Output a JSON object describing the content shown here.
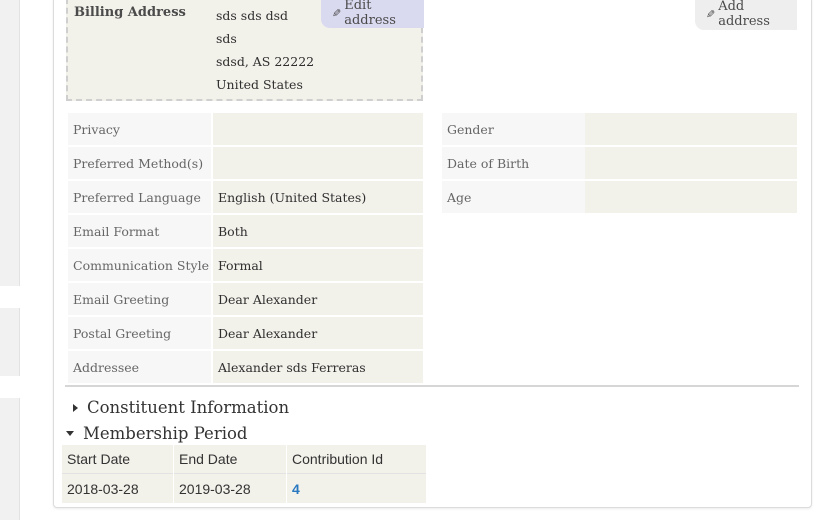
{
  "billing": {
    "label": "Billing Address",
    "lines": [
      "sds sds dsd",
      "sds",
      "sdsd, AS 22222",
      "United States"
    ],
    "edit_label": "Edit address"
  },
  "add_address_label": "Add address",
  "left_fields": [
    {
      "label": "Privacy",
      "value": ""
    },
    {
      "label": "Preferred Method(s)",
      "value": ""
    },
    {
      "label": "Preferred Language",
      "value": "English (United States)"
    },
    {
      "label": "Email Format",
      "value": "Both"
    },
    {
      "label": "Communication Style",
      "value": "Formal"
    },
    {
      "label": "Email Greeting",
      "value": "Dear Alexander"
    },
    {
      "label": "Postal Greeting",
      "value": "Dear Alexander"
    },
    {
      "label": "Addressee",
      "value": "Alexander sds Ferreras"
    }
  ],
  "right_fields": [
    {
      "label": "Gender",
      "value": ""
    },
    {
      "label": "Date of Birth",
      "value": ""
    },
    {
      "label": "Age",
      "value": ""
    }
  ],
  "sections": {
    "constituent": "Constituent Information",
    "membership": "Membership Period"
  },
  "membership_table": {
    "headers": [
      "Start Date",
      "End Date",
      "Contribution Id"
    ],
    "rows": [
      [
        "2018-03-28",
        "2019-03-28",
        "4"
      ]
    ]
  },
  "icons": {
    "edit": "pencil-icon",
    "add": "pencil-icon",
    "collapsed": "triangle-right-icon",
    "expanded": "triangle-down-icon"
  },
  "colors": {
    "link": "#2a79c0",
    "value_bg": "#f2f1ea",
    "edit_button_bg": "#d9d9ef"
  }
}
